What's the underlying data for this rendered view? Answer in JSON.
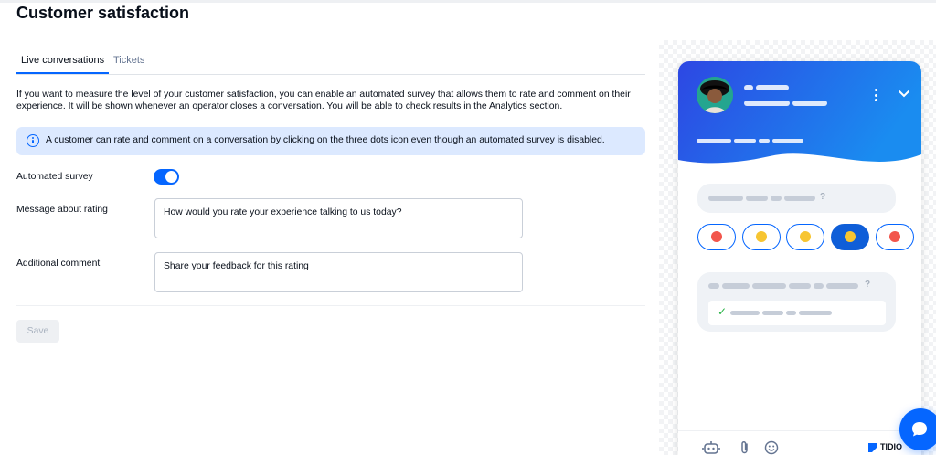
{
  "page": {
    "title": "Customer satisfaction"
  },
  "tabs": [
    {
      "label": "Live conversations",
      "active": true
    },
    {
      "label": "Tickets",
      "active": false
    }
  ],
  "description": "If you want to measure the level of your customer satisfaction, you can enable an automated survey that allows them to rate and comment on their experience. It will be shown whenever an operator closes a conversation. You will be able to check results in the Analytics section.",
  "info": {
    "icon": "info-icon",
    "text": "A customer can rate and comment on a conversation by clicking on the three dots icon even though an automated survey is disabled."
  },
  "form": {
    "automated_survey": {
      "label": "Automated survey",
      "enabled": true
    },
    "message_about_rating": {
      "label": "Message about rating",
      "value": "How would you rate your experience talking to us today?"
    },
    "additional_comment": {
      "label": "Additional comment",
      "value": "Share your feedback for this rating"
    },
    "save_label": "Save"
  },
  "preview": {
    "question_mark": "?",
    "check_glyph": "✓",
    "rating_emojis": [
      {
        "name": "angry",
        "selected": false,
        "color": "#f2564c"
      },
      {
        "name": "unhappy",
        "selected": false,
        "color": "#f7c531"
      },
      {
        "name": "neutral",
        "selected": false,
        "color": "#f7c531"
      },
      {
        "name": "happy",
        "selected": true,
        "color": "#f7c531"
      },
      {
        "name": "love",
        "selected": false,
        "color": "#f2564c"
      }
    ],
    "footer_icons": [
      "bot-icon",
      "attachment-icon",
      "emoji-icon"
    ],
    "brand": "TIDIO"
  },
  "colors": {
    "accent": "#0566ff",
    "header_gradient_start": "#2d47e3",
    "header_gradient_end": "#1a8cf0",
    "info_bg": "#dce9ff"
  }
}
